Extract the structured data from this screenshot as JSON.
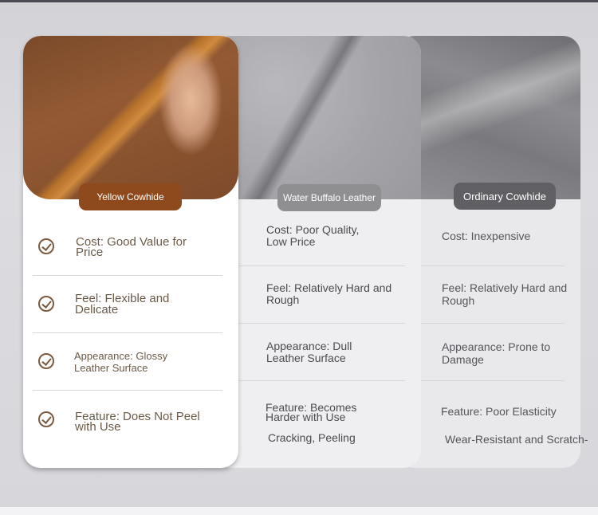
{
  "columns": {
    "yellow_cowhide": {
      "label": "Yellow Cowhide",
      "items": [
        "Cost: Good Value for\nPrice",
        "Feel: Flexible and\nDelicate",
        "Appearance: Glossy\nLeather Surface",
        "Feature: Does Not Peel\nwith Use"
      ]
    },
    "water_buffalo": {
      "label": "Water Buffalo Leather",
      "items": [
        "Cost: Poor Quality,\nLow Price",
        "Feel: Relatively Hard and\nRough",
        "Appearance: Dull\nLeather Surface",
        "Feature: Becomes\nHarder with Use",
        "Cracking, Peeling"
      ]
    },
    "ordinary_cowhide": {
      "label": "Ordinary Cowhide",
      "items": [
        "Cost: Inexpensive",
        "Feel: Relatively Hard and\nRough",
        "Appearance: Prone to\nDamage",
        "Feature: Poor Elasticity",
        "Wear-Resistant and Scratch-"
      ]
    }
  },
  "colors": {
    "accent_brown": "#8e4a1c",
    "check_brown": "#7a5a40",
    "gray_pill": "#8f8f92",
    "dark_pill": "#606064"
  },
  "icons": {
    "check": "check-circle-icon"
  }
}
